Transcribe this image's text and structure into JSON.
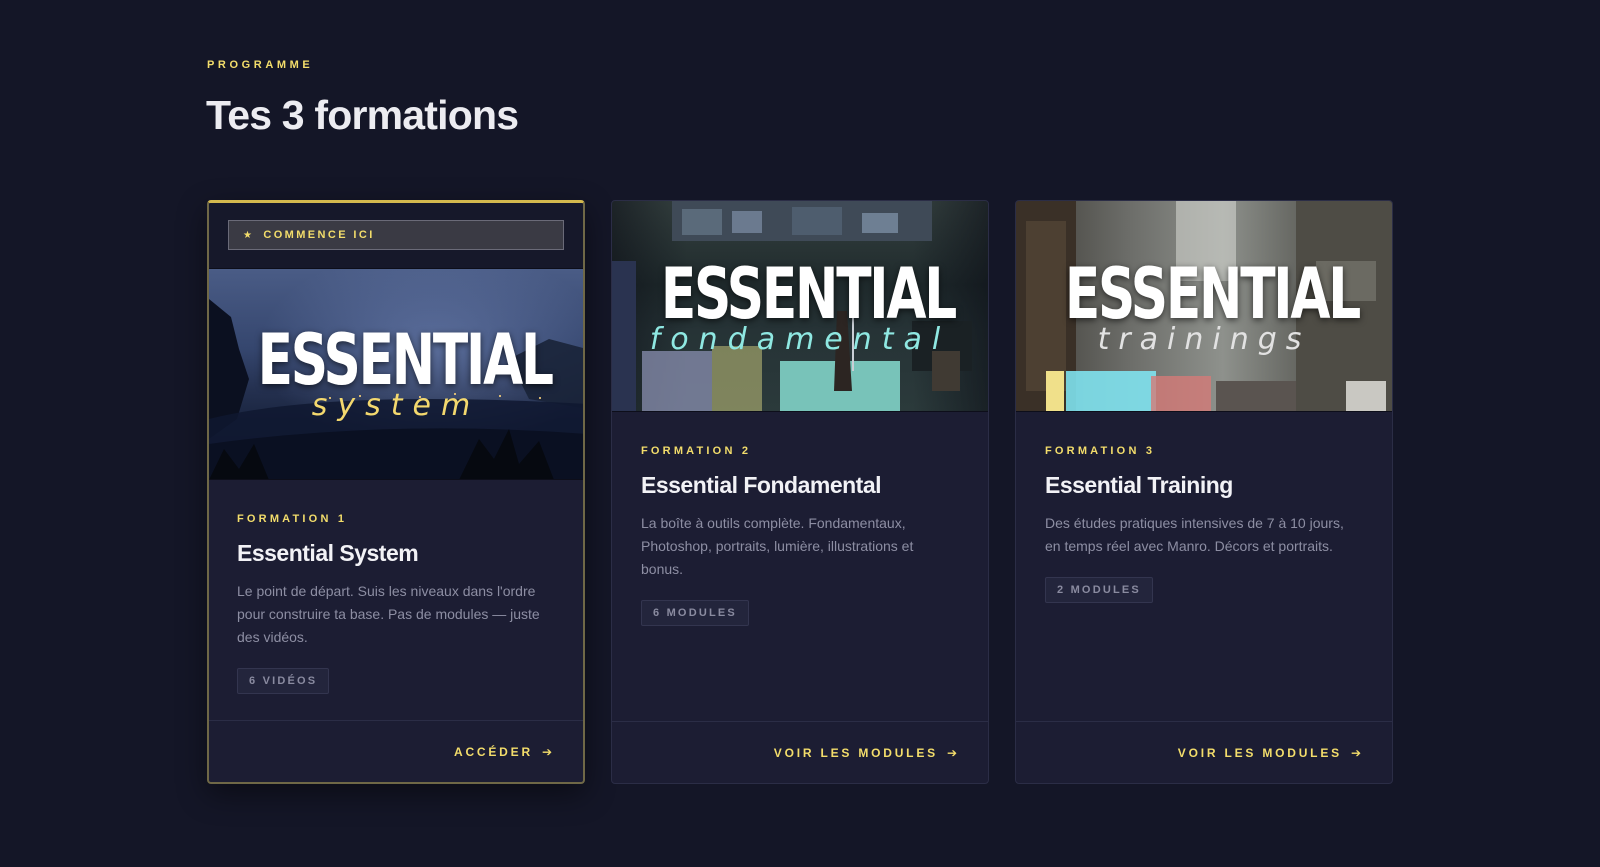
{
  "header": {
    "eyebrow": "PROGRAMME",
    "title": "Tes 3 formations"
  },
  "colors": {
    "background": "#141627",
    "card": "#1c1d33",
    "accent": "#f3dd6b",
    "muted_text": "#8d8ea3"
  },
  "cards": [
    {
      "banner": "COMMENCE ICI",
      "banner_icon": "star-icon",
      "logo_main": "ESSENTIAL",
      "logo_sub": "system",
      "eyebrow": "FORMATION 1",
      "title": "Essential System",
      "description": "Le point de départ. Suis les niveaux dans l'ordre pour construire ta base. Pas de modules — juste des vidéos.",
      "chip": "6 VIDÉOS",
      "cta": "ACCÉDER",
      "cta_icon": "arrow-right-icon"
    },
    {
      "logo_main": "ESSENTIAL",
      "logo_sub": "fondamental",
      "eyebrow": "FORMATION 2",
      "title": "Essential Fondamental",
      "description": "La boîte à outils complète. Fondamentaux, Photoshop, portraits, lumière, illustrations et bonus.",
      "chip": "6 MODULES",
      "cta": "VOIR LES MODULES",
      "cta_icon": "arrow-right-icon"
    },
    {
      "logo_main": "ESSENTIAL",
      "logo_sub": "trainings",
      "eyebrow": "FORMATION 3",
      "title": "Essential Training",
      "description": "Des études pratiques intensives de 7 à 10 jours, en temps réel avec Manro. Décors et portraits.",
      "chip": "2 MODULES",
      "cta": "VOIR LES MODULES",
      "cta_icon": "arrow-right-icon"
    }
  ]
}
